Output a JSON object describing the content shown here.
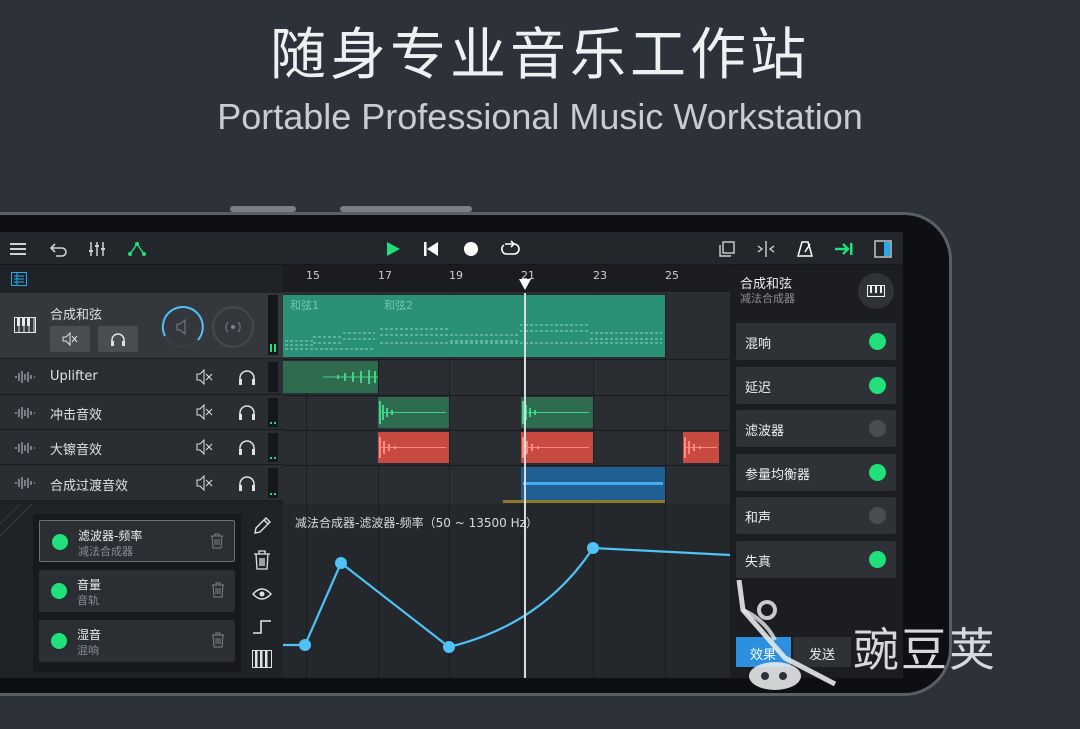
{
  "hero": {
    "title": "随身专业音乐工作站",
    "subtitle": "Portable Professional Music Workstation"
  },
  "toolbar": {
    "icons": [
      "menu-icon",
      "undo-icon",
      "mixer-icon",
      "automation-icon",
      "play-icon",
      "rewind-icon",
      "record-icon",
      "loop-icon",
      "copy-icon",
      "split-icon",
      "metronome-icon",
      "export-icon",
      "panel-toggle-icon"
    ]
  },
  "ruler": {
    "ticks": [
      "15",
      "17",
      "19",
      "21",
      "23",
      "25"
    ]
  },
  "tracks": [
    {
      "name": "合成和弦",
      "type": "synth"
    },
    {
      "name": "Uplifter",
      "type": "audio"
    },
    {
      "name": "冲击音效",
      "type": "audio"
    },
    {
      "name": "大镲音效",
      "type": "audio"
    },
    {
      "name": "合成过渡音效",
      "type": "audio"
    }
  ],
  "clips": {
    "chord1": "和弦1",
    "chord2": "和弦2"
  },
  "automation": {
    "items": [
      {
        "title": "滤波器-频率",
        "sub": "减法合成器"
      },
      {
        "title": "音量",
        "sub": "音轨"
      },
      {
        "title": "湿音",
        "sub": "混响"
      }
    ],
    "graph_label": "减法合成器-滤波器-频率（50 ~ 13500 Hz）",
    "tools": [
      "pencil-icon",
      "trash-icon",
      "eye-icon",
      "step-icon",
      "piano-icon"
    ]
  },
  "instrument": {
    "name": "合成和弦",
    "sub": "减法合成器"
  },
  "effects": [
    {
      "label": "混响",
      "on": true
    },
    {
      "label": "延迟",
      "on": true
    },
    {
      "label": "滤波器",
      "on": false
    },
    {
      "label": "参量均衡器",
      "on": true
    },
    {
      "label": "和声",
      "on": false
    },
    {
      "label": "失真",
      "on": true
    }
  ],
  "bottom_tabs": {
    "effects": "效果",
    "send": "发送"
  },
  "watermark": {
    "text": "豌豆荚"
  },
  "colors": {
    "accent_green": "#1fe07a",
    "clip_teal": "#2aa383",
    "clip_red": "#c94a40",
    "clip_blue": "#1f5f94",
    "automation_line": "#4fc3f7",
    "tab_blue": "#2c8fe0"
  }
}
